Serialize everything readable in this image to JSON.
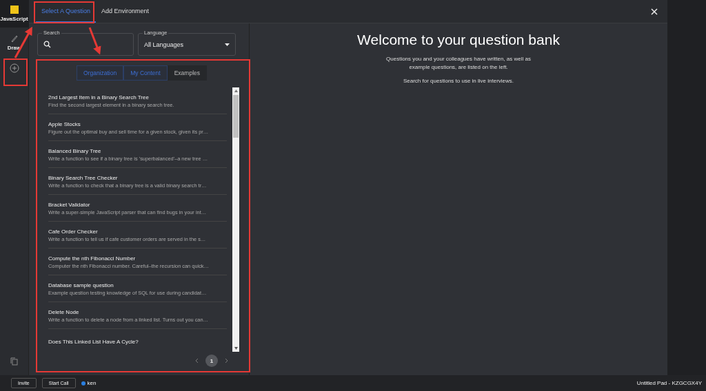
{
  "rail": {
    "language": "JavaScript",
    "items": [
      {
        "label": "Draw"
      }
    ]
  },
  "tabs": [
    {
      "label": "Select A Question",
      "selected": true
    },
    {
      "label": "Add Environment",
      "selected": false
    }
  ],
  "search": {
    "label": "Search"
  },
  "language": {
    "label": "Language",
    "value": "All Languages"
  },
  "filter_tabs": [
    {
      "label": "Organization",
      "selected": true
    },
    {
      "label": "My Content",
      "selected": true
    },
    {
      "label": "Examples",
      "selected": false
    }
  ],
  "questions": [
    {
      "title": "2nd Largest Item in a Binary Search Tree",
      "description": "Find the second largest element in a binary search tree."
    },
    {
      "title": "Apple Stocks",
      "description": "Figure out the optimal buy and sell time for a given stock, given its pr…"
    },
    {
      "title": "Balanced Binary Tree",
      "description": "Write a function to see if a binary tree is 'superbalanced'–a new tree …"
    },
    {
      "title": "Binary Search Tree Checker",
      "description": "Write a function to check that a binary tree is a valid binary search tr…"
    },
    {
      "title": "Bracket Validator",
      "description": "Write a super-simple JavaScript parser that can find bugs in your int…"
    },
    {
      "title": "Cafe Order Checker",
      "description": "Write a function to tell us if cafe customer orders are served in the s…"
    },
    {
      "title": "Compute the nth Fibonacci Number",
      "description": "Computer the nth Fibonacci number. Careful–the recursion can quick…"
    },
    {
      "title": "Database sample question",
      "description": "Example question testing knowledge of SQL for use during candidat…"
    },
    {
      "title": "Delete Node",
      "description": "Write a function to delete a node from a linked list. Turns out you can…"
    },
    {
      "title": "Does This Linked List Have A Cycle?"
    }
  ],
  "pagination": {
    "page": "1"
  },
  "welcome": {
    "title": "Welcome to your question bank",
    "paragraphs": [
      "Questions you and your colleagues have written, as well as example questions, are listed on the left.",
      "Search for questions to use in live interviews."
    ]
  },
  "bottom_bar": {
    "buttons": [
      "Invite",
      "Start Call"
    ],
    "user": "ken",
    "pad": "Untitled Pad - KZGCGX4Y"
  }
}
